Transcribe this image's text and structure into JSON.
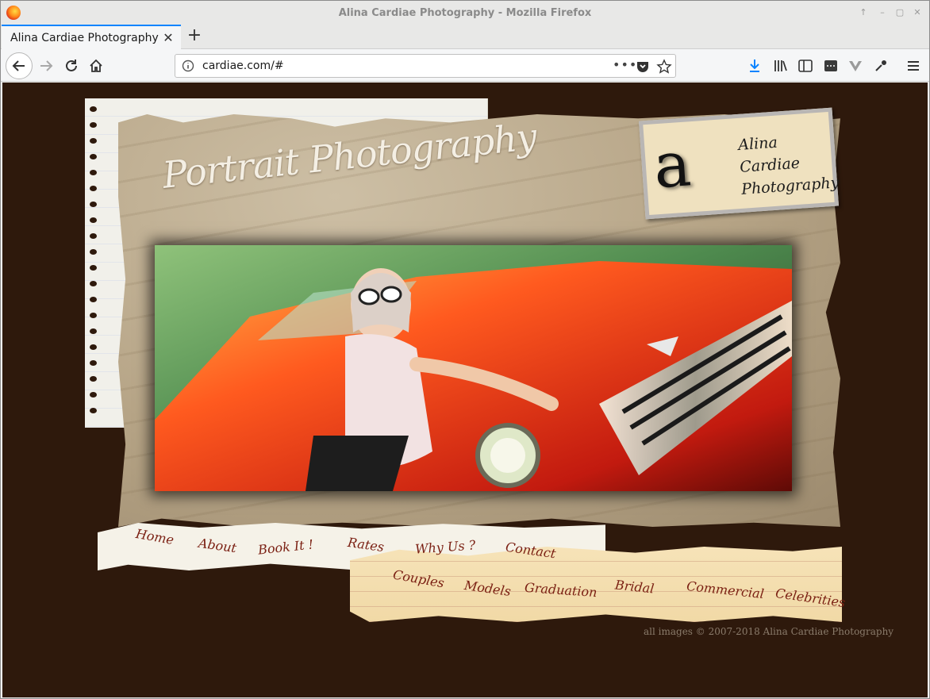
{
  "window": {
    "title": "Alina Cardiae Photography - Mozilla Firefox"
  },
  "tabs": [
    {
      "label": "Alina Cardiae Photography"
    }
  ],
  "new_tab_label": "+",
  "url": {
    "value": "cardiae.com/#",
    "more_label": "•••"
  },
  "page": {
    "heading": "Portrait Photography",
    "logo": {
      "mark": "a",
      "lines": [
        "Alina",
        "Cardiae",
        "Photography"
      ]
    },
    "nav_primary": [
      "Home",
      "About",
      "Book It !",
      "Rates",
      "Why Us ?",
      "Contact"
    ],
    "nav_secondary": [
      "Couples",
      "Models",
      "Graduation",
      "Bridal",
      "Commercial",
      "Celebrities"
    ],
    "footer": "all images © 2007-2018 Alina Cardiae Photography"
  },
  "colors": {
    "background": "#2e190c",
    "link": "#7a1f12",
    "accent_tab": "#0a84ff"
  }
}
